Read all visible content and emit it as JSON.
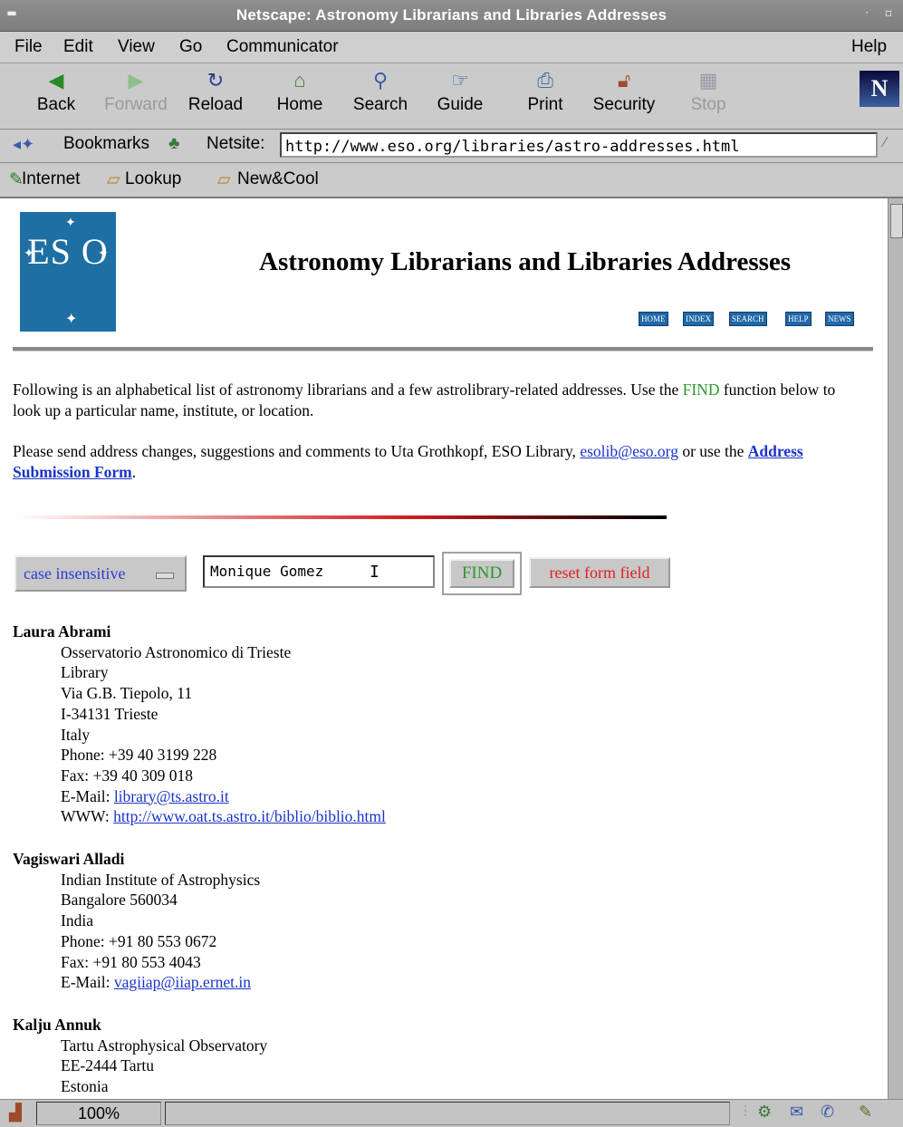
{
  "window": {
    "title": "Netscape: Astronomy Librarians and Libraries Addresses"
  },
  "menu": {
    "items": [
      "File",
      "Edit",
      "View",
      "Go",
      "Communicator"
    ],
    "help": "Help"
  },
  "toolbar": {
    "buttons": [
      {
        "label": "Back",
        "icon": "back-arrow-icon"
      },
      {
        "label": "Forward",
        "icon": "forward-arrow-icon"
      },
      {
        "label": "Reload",
        "icon": "reload-icon"
      },
      {
        "label": "Home",
        "icon": "home-icon"
      },
      {
        "label": "Search",
        "icon": "search-icon"
      },
      {
        "label": "Guide",
        "icon": "guide-icon"
      },
      {
        "label": "Print",
        "icon": "print-icon"
      },
      {
        "label": "Security",
        "icon": "security-lock-icon"
      },
      {
        "label": "Stop",
        "icon": "stop-icon"
      }
    ],
    "logo": "N"
  },
  "location": {
    "bookmarks_label": "Bookmarks",
    "netsite_label": "Netsite:",
    "url": "http://www.eso.org/libraries/astro-addresses.html"
  },
  "personal_toolbar": {
    "items": [
      "Internet",
      "Lookup",
      "New&Cool"
    ]
  },
  "page": {
    "logo_text": "ES O",
    "heading": "Astronomy Librarians and Libraries Addresses",
    "nav": [
      "HOME",
      "INDEX",
      "SEARCH",
      "HELP",
      "NEWS"
    ],
    "intro": {
      "p1_before": "Following is an alphabetical list of astronomy librarians and a few astrolibrary-related addresses. Use the ",
      "p1_find": "FIND",
      "p1_after": " function below to look up a particular name, institute, or location.",
      "p2_before": "Please send address changes, suggestions and comments to Uta Grothkopf, ESO Library, ",
      "p2_email": "esolib@eso.org",
      "p2_middle": " or use the ",
      "p2_link": "Address Submission Form",
      "p2_after": "."
    },
    "search": {
      "mode": "case insensitive",
      "value": "Monique Gomez",
      "find_label": "FIND",
      "reset_label": "reset form field"
    },
    "entries": [
      {
        "name": "Laura Abrami",
        "lines": [
          "Osservatorio Astronomico di Trieste",
          "Library",
          "Via G.B. Tiepolo, 11",
          "I-34131 Trieste",
          "Italy",
          "Phone: +39 40 3199 228",
          "Fax: +39 40 309 018"
        ],
        "email_label": "E-Mail: ",
        "email": "library@ts.astro.it",
        "www_label": "WWW: ",
        "www": "http://www.oat.ts.astro.it/biblio/biblio.html"
      },
      {
        "name": "Vagiswari Alladi",
        "lines": [
          "Indian Institute of Astrophysics",
          "Bangalore 560034",
          "India",
          "Phone: +91 80 553 0672",
          "Fax: +91 80 553 4043"
        ],
        "email_label": "E-Mail: ",
        "email": "vagiiap@iiap.ernet.in"
      },
      {
        "name": "Kalju Annuk",
        "lines": [
          "Tartu Astrophysical Observatory",
          "EE-2444 Tartu",
          "Estonia"
        ]
      }
    ]
  },
  "status": {
    "zoom": "100%"
  }
}
